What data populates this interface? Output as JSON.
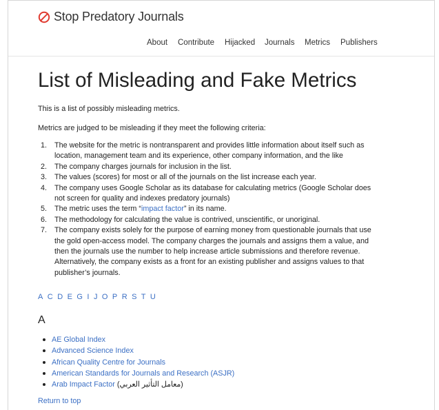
{
  "brand": {
    "icon": "no-entry-icon",
    "icon_color": "#e03a2f",
    "name": "Stop Predatory Journals"
  },
  "nav": [
    "About",
    "Contribute",
    "Hijacked",
    "Journals",
    "Metrics",
    "Publishers"
  ],
  "page": {
    "title": "List of Misleading and Fake Metrics",
    "intro": "This is a list of possibly misleading metrics.",
    "criteria_intro": "Metrics are judged to be misleading if they meet the following criteria:",
    "criteria": [
      {
        "num": "1.",
        "lines": [
          "The website for the metric is nontransparent and provides little information about itself such as",
          "location, management team and its experience, other company information, and the like"
        ]
      },
      {
        "num": "2.",
        "lines": [
          "The company charges journals for inclusion in the list."
        ]
      },
      {
        "num": "3.",
        "lines": [
          "The values (scores) for most or all of the journals on the list increase each year."
        ]
      },
      {
        "num": "4.",
        "lines": [
          "The company uses Google Scholar as its database for calculating metrics (Google Scholar does",
          "not screen for quality and indexes predatory journals)"
        ]
      },
      {
        "num": "5.",
        "before": "The metric uses the term “",
        "link": "impact factor",
        "after": "” in its name."
      },
      {
        "num": "6.",
        "lines": [
          "The methodology for calculating the value is contrived, unscientific, or unoriginal."
        ]
      },
      {
        "num": "7.",
        "lines": [
          "The company exists solely for the purpose of earning money from questionable journals that use",
          "the gold open-access model. The company charges the journals and assigns them a value, and",
          "then the journals use the number to help increase article submissions and therefore revenue.",
          "Alternatively, the company exists as a front for an existing publisher and assigns values to that",
          "publisher’s journals."
        ]
      }
    ],
    "letters": [
      "A",
      "C",
      "D",
      "E",
      "G",
      "I",
      "J",
      "O",
      "P",
      "R",
      "S",
      "T",
      "U"
    ],
    "section_heading": "A",
    "section_items": [
      {
        "text": "AE Global Index"
      },
      {
        "text": "Advanced Science Index"
      },
      {
        "text": "African Quality Centre for Journals"
      },
      {
        "text": "American Standards for Journals and Research (ASJR)"
      },
      {
        "text": "Arab Impact Factor",
        "suffix": "(معامل التأثير العربي)"
      }
    ],
    "return_to_top": "Return to top"
  },
  "colors": {
    "link": "#3b6fc4",
    "text": "#222222",
    "brand_icon": "#e03a2f"
  }
}
